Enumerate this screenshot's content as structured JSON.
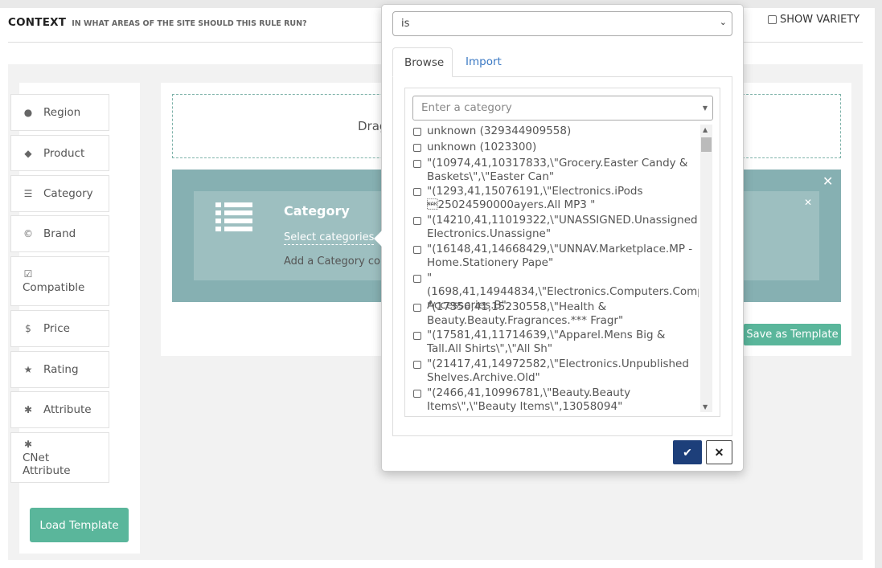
{
  "header": {
    "title": "CONTEXT",
    "subtitle": "IN WHAT AREAS OF THE SITE SHOULD THIS RULE RUN?",
    "show_variety": "SHOW VARIETY"
  },
  "sidebar": {
    "items": [
      {
        "label": "Region",
        "icon": "globe-icon"
      },
      {
        "label": "Product",
        "icon": "tag-icon"
      },
      {
        "label": "Category",
        "icon": "list-icon"
      },
      {
        "label": "Brand",
        "icon": "copyright-icon"
      },
      {
        "label": "Compatible",
        "icon": "check-square-icon"
      },
      {
        "label": "Price",
        "icon": "dollar-icon"
      },
      {
        "label": "Rating",
        "icon": "star-icon"
      },
      {
        "label": "Attribute",
        "icon": "asterisk-icon"
      },
      {
        "label": "CNet Attribute",
        "icon": "asterisk-icon"
      }
    ],
    "load_template": "Load Template"
  },
  "canvas": {
    "dropzone_text": "Drag",
    "category_block": {
      "title": "Category",
      "select_link": "Select categories",
      "add_text": "Add a Category co"
    },
    "save_template": "Save as Template"
  },
  "popover": {
    "operator": "is",
    "tabs": [
      "Browse",
      "Import"
    ],
    "search_placeholder": "Enter a category",
    "options": [
      "unknown (329344909558)",
      "unknown (1023300)",
      "\"(10974,41,10317833,\\\"Grocery.Easter Candy & Baskets\\\",\\\"Easter Can\"",
      "\"(1293,41,15076191,\\\"Electronics.iPods \u001525024590000ayers.All MP3 \"",
      "\"(14210,41,11019322,\\\"UNASSIGNED.Unassigned Electronics.Unassigne\"",
      "\"(16148,41,14668429,\\\"UNNAV.Marketplace.MP - Home.Stationery Pape\"",
      "\"(1698,41,14944834,\\\"Electronics.Computers.Computer Accessories.B\"",
      "\"(17356,41,15230558,\\\"Health & Beauty.Beauty.Fragrances.*** Fragr\"",
      "\"(17581,41,11714639,\\\"Apparel.Mens Big & Tall.All Shirts\\\",\\\"All Sh\"",
      "\"(21417,41,14972582,\\\"Electronics.Unpublished Shelves.Archive.Old\"",
      "\"(2466,41,10996781,\\\"Beauty.Beauty Items\\\",\\\"Beauty Items\\\",13058094\""
    ]
  },
  "colors": {
    "accent_green": "#5ab69b",
    "teal_outer": "#86b0b2",
    "teal_inner": "#9dbfc0",
    "confirm_blue": "#1d3f7a",
    "link_blue": "#3a78c3"
  }
}
